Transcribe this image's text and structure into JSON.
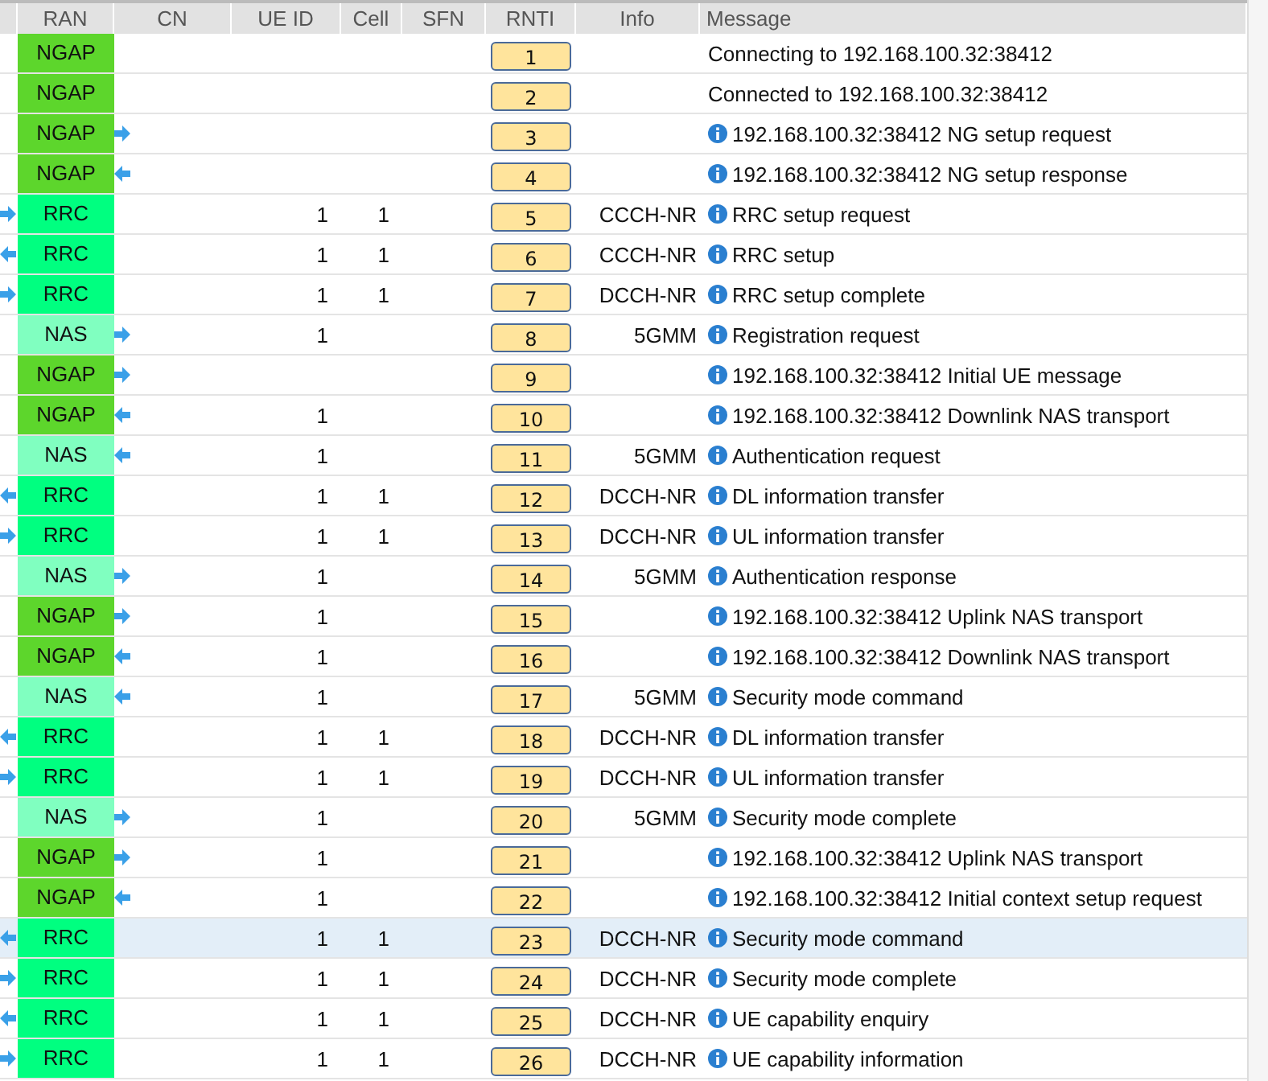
{
  "columns": [
    "RAN",
    "CN",
    "UE ID",
    "Cell",
    "SFN",
    "RNTI",
    "Info",
    "Message"
  ],
  "rows": [
    {
      "protocol": "NGAP",
      "color": "#5dd62c",
      "arrow_right": false,
      "arrow_left": false,
      "ue_id": "",
      "cell": "",
      "rnti": "1",
      "info": "",
      "info_icon": false,
      "message": "Connecting to 192.168.100.32:38412",
      "selected": false
    },
    {
      "protocol": "NGAP",
      "color": "#5dd62c",
      "arrow_right": false,
      "arrow_left": false,
      "ue_id": "",
      "cell": "",
      "rnti": "2",
      "info": "",
      "info_icon": false,
      "message": "Connected to 192.168.100.32:38412",
      "selected": false
    },
    {
      "protocol": "NGAP",
      "color": "#5dd62c",
      "arrow_right": true,
      "arrow_left": false,
      "ue_id": "",
      "cell": "",
      "rnti": "3",
      "info": "",
      "info_icon": true,
      "message": "192.168.100.32:38412 NG setup request",
      "selected": false
    },
    {
      "protocol": "NGAP",
      "color": "#5dd62c",
      "arrow_right": false,
      "arrow_left": true,
      "ue_id": "",
      "cell": "",
      "rnti": "4",
      "info": "",
      "info_icon": true,
      "message": "192.168.100.32:38412 NG setup response",
      "selected": false
    },
    {
      "protocol": "RRC",
      "color": "#00ff80",
      "arrow_right": true,
      "arrow_left": false,
      "ue_id": "1",
      "cell": "1",
      "rnti": "5",
      "info": "CCCH-NR",
      "info_icon": true,
      "message": "RRC setup request",
      "selected": false
    },
    {
      "protocol": "RRC",
      "color": "#00ff80",
      "arrow_right": false,
      "arrow_left": true,
      "ue_id": "1",
      "cell": "1",
      "rnti": "6",
      "info": "CCCH-NR",
      "info_icon": true,
      "message": "RRC setup",
      "selected": false
    },
    {
      "protocol": "RRC",
      "color": "#00ff80",
      "arrow_right": true,
      "arrow_left": false,
      "ue_id": "1",
      "cell": "1",
      "rnti": "7",
      "info": "DCCH-NR",
      "info_icon": true,
      "message": "RRC setup complete",
      "selected": false
    },
    {
      "protocol": "NAS",
      "color": "#80ffc0",
      "arrow_right": true,
      "arrow_left": false,
      "ue_id": "1",
      "cell": "",
      "rnti": "8",
      "info": "5GMM",
      "info_icon": true,
      "message": "Registration request",
      "selected": false
    },
    {
      "protocol": "NGAP",
      "color": "#5dd62c",
      "arrow_right": true,
      "arrow_left": false,
      "ue_id": "",
      "cell": "",
      "rnti": "9",
      "info": "",
      "info_icon": true,
      "message": "192.168.100.32:38412 Initial UE message",
      "selected": false
    },
    {
      "protocol": "NGAP",
      "color": "#5dd62c",
      "arrow_right": false,
      "arrow_left": true,
      "ue_id": "1",
      "cell": "",
      "rnti": "10",
      "info": "",
      "info_icon": true,
      "message": "192.168.100.32:38412 Downlink NAS transport",
      "selected": false
    },
    {
      "protocol": "NAS",
      "color": "#80ffc0",
      "arrow_right": false,
      "arrow_left": true,
      "ue_id": "1",
      "cell": "",
      "rnti": "11",
      "info": "5GMM",
      "info_icon": true,
      "message": "Authentication request",
      "selected": false
    },
    {
      "protocol": "RRC",
      "color": "#00ff80",
      "arrow_right": false,
      "arrow_left": true,
      "ue_id": "1",
      "cell": "1",
      "rnti": "12",
      "info": "DCCH-NR",
      "info_icon": true,
      "message": "DL information transfer",
      "selected": false
    },
    {
      "protocol": "RRC",
      "color": "#00ff80",
      "arrow_right": true,
      "arrow_left": false,
      "ue_id": "1",
      "cell": "1",
      "rnti": "13",
      "info": "DCCH-NR",
      "info_icon": true,
      "message": "UL information transfer",
      "selected": false
    },
    {
      "protocol": "NAS",
      "color": "#80ffc0",
      "arrow_right": true,
      "arrow_left": false,
      "ue_id": "1",
      "cell": "",
      "rnti": "14",
      "info": "5GMM",
      "info_icon": true,
      "message": "Authentication response",
      "selected": false
    },
    {
      "protocol": "NGAP",
      "color": "#5dd62c",
      "arrow_right": true,
      "arrow_left": false,
      "ue_id": "1",
      "cell": "",
      "rnti": "15",
      "info": "",
      "info_icon": true,
      "message": "192.168.100.32:38412 Uplink NAS transport",
      "selected": false
    },
    {
      "protocol": "NGAP",
      "color": "#5dd62c",
      "arrow_right": false,
      "arrow_left": true,
      "ue_id": "1",
      "cell": "",
      "rnti": "16",
      "info": "",
      "info_icon": true,
      "message": "192.168.100.32:38412 Downlink NAS transport",
      "selected": false
    },
    {
      "protocol": "NAS",
      "color": "#80ffc0",
      "arrow_right": false,
      "arrow_left": true,
      "ue_id": "1",
      "cell": "",
      "rnti": "17",
      "info": "5GMM",
      "info_icon": true,
      "message": "Security mode command",
      "selected": false
    },
    {
      "protocol": "RRC",
      "color": "#00ff80",
      "arrow_right": false,
      "arrow_left": true,
      "ue_id": "1",
      "cell": "1",
      "rnti": "18",
      "info": "DCCH-NR",
      "info_icon": true,
      "message": "DL information transfer",
      "selected": false
    },
    {
      "protocol": "RRC",
      "color": "#00ff80",
      "arrow_right": true,
      "arrow_left": false,
      "ue_id": "1",
      "cell": "1",
      "rnti": "19",
      "info": "DCCH-NR",
      "info_icon": true,
      "message": "UL information transfer",
      "selected": false
    },
    {
      "protocol": "NAS",
      "color": "#80ffc0",
      "arrow_right": true,
      "arrow_left": false,
      "ue_id": "1",
      "cell": "",
      "rnti": "20",
      "info": "5GMM",
      "info_icon": true,
      "message": "Security mode complete",
      "selected": false
    },
    {
      "protocol": "NGAP",
      "color": "#5dd62c",
      "arrow_right": true,
      "arrow_left": false,
      "ue_id": "1",
      "cell": "",
      "rnti": "21",
      "info": "",
      "info_icon": true,
      "message": "192.168.100.32:38412 Uplink NAS transport",
      "selected": false
    },
    {
      "protocol": "NGAP",
      "color": "#5dd62c",
      "arrow_right": false,
      "arrow_left": true,
      "ue_id": "1",
      "cell": "",
      "rnti": "22",
      "info": "",
      "info_icon": true,
      "message": "192.168.100.32:38412 Initial context setup request",
      "selected": false
    },
    {
      "protocol": "RRC",
      "color": "#00ff80",
      "arrow_right": false,
      "arrow_left": true,
      "ue_id": "1",
      "cell": "1",
      "rnti": "23",
      "info": "DCCH-NR",
      "info_icon": true,
      "message": "Security mode command",
      "selected": true
    },
    {
      "protocol": "RRC",
      "color": "#00ff80",
      "arrow_right": true,
      "arrow_left": false,
      "ue_id": "1",
      "cell": "1",
      "rnti": "24",
      "info": "DCCH-NR",
      "info_icon": true,
      "message": "Security mode complete",
      "selected": false
    },
    {
      "protocol": "RRC",
      "color": "#00ff80",
      "arrow_right": false,
      "arrow_left": true,
      "ue_id": "1",
      "cell": "1",
      "rnti": "25",
      "info": "DCCH-NR",
      "info_icon": true,
      "message": "UE capability enquiry",
      "selected": false
    },
    {
      "protocol": "RRC",
      "color": "#00ff80",
      "arrow_right": true,
      "arrow_left": false,
      "ue_id": "1",
      "cell": "1",
      "rnti": "26",
      "info": "DCCH-NR",
      "info_icon": true,
      "message": "UE capability information",
      "selected": false
    }
  ]
}
